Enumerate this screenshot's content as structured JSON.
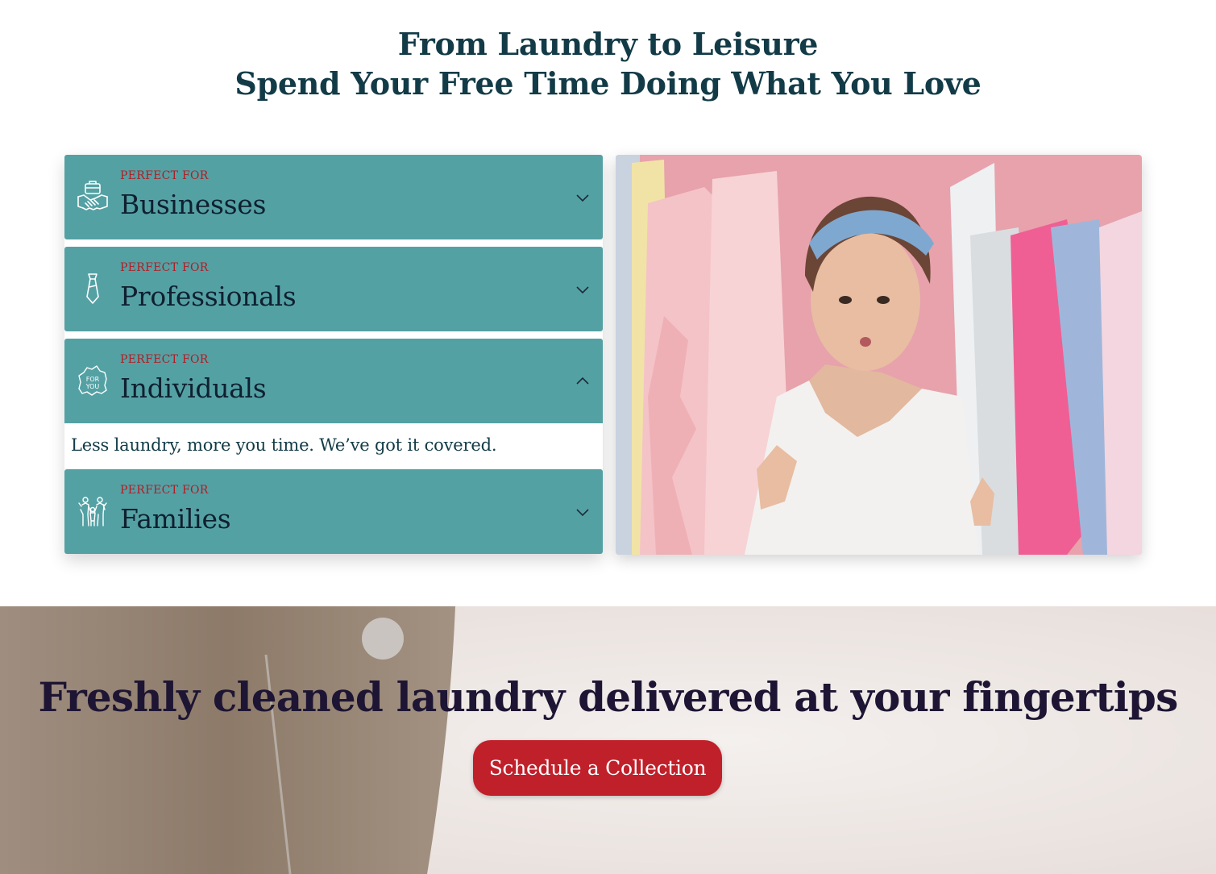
{
  "hero": {
    "line1": "From Laundry to Leisure",
    "line2": "Spend Your Free Time Doing What You Love"
  },
  "accordion": {
    "items": [
      {
        "kicker": "PERFECT FOR",
        "title": "Businesses",
        "icon": "handshake-briefcase-icon",
        "expanded": false
      },
      {
        "kicker": "PERFECT FOR",
        "title": "Professionals",
        "icon": "necktie-icon",
        "expanded": false
      },
      {
        "kicker": "PERFECT FOR",
        "title": "Individuals",
        "icon": "for-you-icon",
        "expanded": true,
        "body": "Less laundry, more you time. We’ve got it covered."
      },
      {
        "kicker": "PERFECT FOR",
        "title": "Families",
        "icon": "family-icon",
        "expanded": false
      }
    ]
  },
  "banner": {
    "heading": "Freshly cleaned laundry delivered at your fingertips",
    "cta_label": "Schedule a Collection"
  },
  "colors": {
    "accordion_bg": "#54a1a4",
    "kicker": "#b01c24",
    "heading": "#123b47",
    "cta_bg": "#c0202a"
  }
}
